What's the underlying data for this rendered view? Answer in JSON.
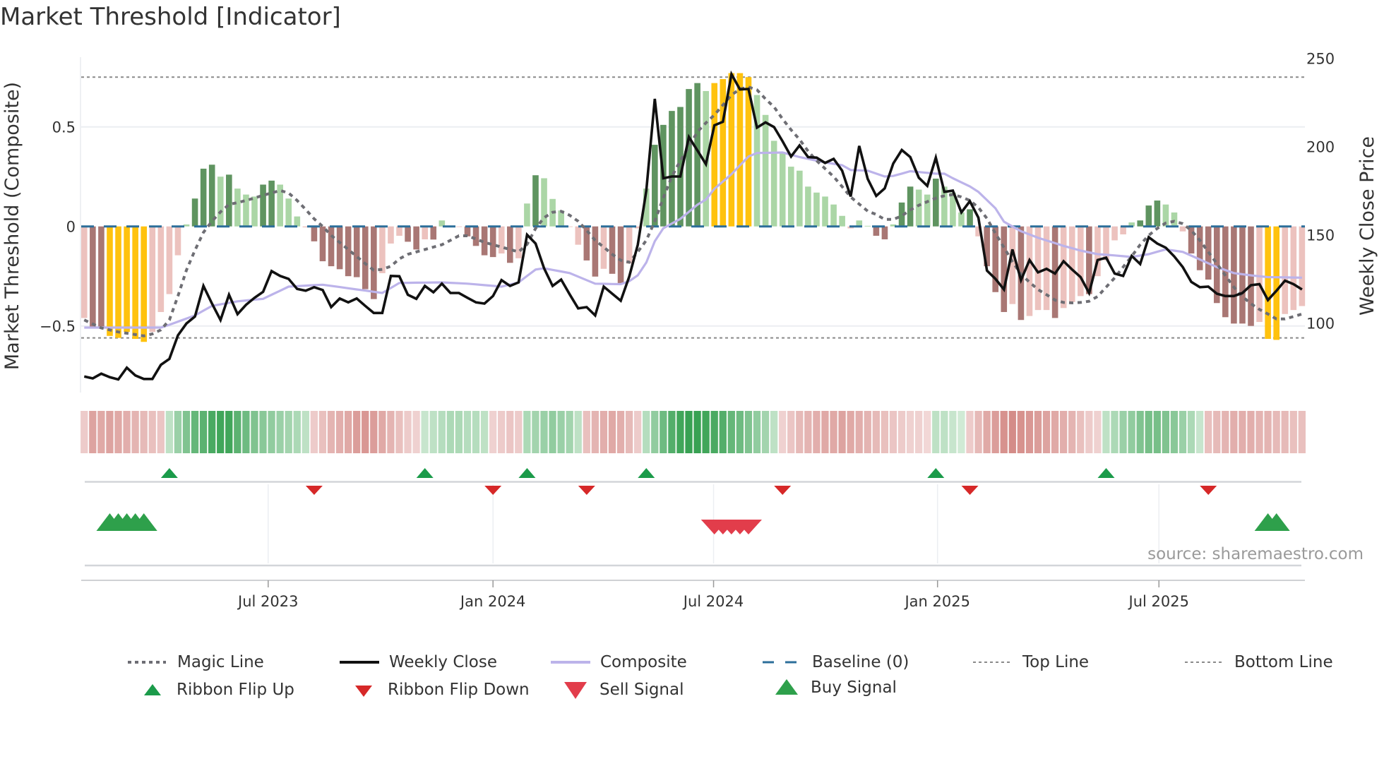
{
  "title": "Market Threshold [Indicator]",
  "source": "source: sharemaestro.com",
  "colors": {
    "bar_dark_red": "#a97774",
    "bar_light_red": "#ecc2be",
    "bar_dark_green": "#5f9460",
    "bar_light_green": "#abd6a6",
    "bar_yellow": "#ffc20e",
    "close": "#111111",
    "composite": "#bcb3ea",
    "magic": "#6e6e74",
    "baseline": "#2c6e9a",
    "threshold": "#8a8a8a",
    "flip_up": "#1b9b4a",
    "flip_down": "#d62828",
    "sell": "#e23d4b",
    "buy": "#2ea04b"
  },
  "chart_data": {
    "type": "bar+line",
    "title": "Market Threshold [Indicator]",
    "ylabel_left": "Market Threshold (Composite)",
    "ylabel_right": "Weekly Close Price",
    "ylim_left": [
      -0.85,
      0.85
    ],
    "ylim_right": [
      50,
      265
    ],
    "y_ticks_left": [
      {
        "label": "0.5",
        "value": 0.5
      },
      {
        "label": "0",
        "value": 0
      },
      {
        "label": "−0.5",
        "value": -0.5
      }
    ],
    "y_ticks_right": [
      {
        "label": "250",
        "value": 250
      },
      {
        "label": "200",
        "value": 200
      },
      {
        "label": "150",
        "value": 150
      },
      {
        "label": "100",
        "value": 100
      }
    ],
    "x_ticks": [
      {
        "label": "Jul 2023",
        "week": 22.6
      },
      {
        "label": "Jan 2024",
        "week": 49
      },
      {
        "label": "Jul 2024",
        "week": 74.9
      },
      {
        "label": "Jan 2025",
        "week": 101.2
      },
      {
        "label": "Jul 2025",
        "week": 127.2
      }
    ],
    "top_line": 0.75,
    "bottom_line": -0.56,
    "baseline": 0,
    "composite_bars": [
      -0.46,
      -0.51,
      -0.51,
      -0.55,
      -0.56,
      -0.53,
      -0.565,
      -0.58,
      -0.53,
      -0.43,
      -0.34,
      -0.145,
      0.01,
      0.14,
      0.29,
      0.31,
      0.25,
      0.26,
      0.19,
      0.16,
      0.15,
      0.21,
      0.23,
      0.21,
      0.14,
      0.05,
      -0.005,
      -0.075,
      -0.175,
      -0.2,
      -0.215,
      -0.25,
      -0.255,
      -0.315,
      -0.365,
      -0.235,
      -0.086,
      -0.047,
      -0.077,
      -0.116,
      -0.065,
      -0.066,
      0.03,
      0.003,
      -0.003,
      -0.05,
      -0.098,
      -0.145,
      -0.154,
      -0.136,
      -0.183,
      -0.16,
      0.115,
      0.257,
      0.242,
      0.138,
      0.08,
      -0.003,
      -0.092,
      -0.171,
      -0.252,
      -0.213,
      -0.238,
      -0.287,
      -0.187,
      -0.01,
      0.19,
      0.41,
      0.51,
      0.58,
      0.6,
      0.69,
      0.72,
      0.68,
      0.72,
      0.74,
      0.77,
      0.77,
      0.75,
      0.66,
      0.56,
      0.43,
      0.37,
      0.3,
      0.28,
      0.2,
      0.17,
      0.15,
      0.11,
      0.053,
      -0.01,
      0.03,
      0.003,
      -0.047,
      -0.065,
      0.01,
      0.12,
      0.2,
      0.185,
      0.16,
      0.24,
      0.2,
      0.17,
      0.07,
      0.086,
      -0.05,
      -0.2,
      -0.33,
      -0.43,
      -0.39,
      -0.47,
      -0.45,
      -0.42,
      -0.42,
      -0.46,
      -0.41,
      -0.38,
      -0.35,
      -0.34,
      -0.25,
      -0.17,
      -0.07,
      -0.04,
      0.02,
      0.03,
      0.105,
      0.13,
      0.11,
      0.07,
      -0.025,
      -0.136,
      -0.22,
      -0.267,
      -0.385,
      -0.456,
      -0.488,
      -0.488,
      -0.5,
      -0.48,
      -0.565,
      -0.57,
      -0.44,
      -0.42,
      -0.4
    ],
    "bar_states": "LDDYYYYYLLLLgGGGgGgggGGgggLDDDDDDDDLLLDDLDggLDDDDLDLgGgggLLDDLDDLLgGGGGGGgYYYYYgggggggggggLggDDgGGggGgggGLDDDLDLLLDLLLDLLLLgGGGggLDDDDDDDDLYYLLL",
    "bar_state_legend": {
      "D": "strong negative",
      "L": "weak negative",
      "G": "strong positive",
      "g": "weak positive",
      "Y": "extreme"
    },
    "weekly_close": [
      69.7,
      68.6,
      71.3,
      69.3,
      68,
      74.7,
      70.3,
      68.3,
      68.3,
      76.3,
      79.7,
      93,
      99.7,
      103.7,
      121,
      111,
      101.7,
      116,
      105,
      110.3,
      114.3,
      117.7,
      129.4,
      126.7,
      125,
      119.3,
      118.3,
      120.3,
      118.7,
      109,
      113.9,
      111.7,
      113.9,
      109.7,
      105.7,
      105.7,
      126.7,
      126.5,
      116,
      113.7,
      121,
      117.4,
      122.3,
      117,
      117,
      114.3,
      111.7,
      111,
      115.3,
      124.3,
      121,
      123,
      150,
      145,
      131,
      121,
      124.6,
      116.3,
      108.3,
      109,
      104.3,
      120.6,
      116.6,
      112.6,
      126.3,
      144.3,
      175,
      227,
      182,
      183,
      183,
      205.4,
      197.8,
      190,
      212,
      214,
      241,
      232.3,
      232.6,
      210.7,
      213.7,
      211,
      203,
      194.3,
      200.6,
      194,
      193.7,
      190.7,
      193,
      186.3,
      171.7,
      200.3,
      181.7,
      172,
      176.3,
      190.3,
      198,
      194,
      182.3,
      177.7,
      193.7,
      174.3,
      175,
      162.7,
      169,
      159.7,
      129.7,
      125,
      119,
      141.7,
      124.3,
      135.7,
      128.7,
      130.7,
      128,
      135,
      130.3,
      126,
      117,
      135.7,
      137,
      128,
      126.7,
      138,
      133.4,
      148.6,
      145,
      142.7,
      137.7,
      131.7,
      123.3,
      120.3,
      120.6,
      116.6,
      115.3,
      115.3,
      117,
      121.4,
      122,
      113,
      118.3,
      124,
      122,
      119
    ],
    "composite_line_knots": [
      [
        1,
        97.4
      ],
      [
        10,
        97.4
      ],
      [
        11,
        99
      ],
      [
        14,
        104.3
      ],
      [
        16,
        109.7
      ],
      [
        19,
        112.3
      ],
      [
        22,
        113.7
      ],
      [
        25,
        120.6
      ],
      [
        29,
        121.7
      ],
      [
        36,
        117
      ],
      [
        38,
        122.7
      ],
      [
        43,
        123
      ],
      [
        46,
        122.3
      ],
      [
        50,
        120.6
      ],
      [
        52,
        123
      ],
      [
        54,
        130.3
      ],
      [
        55,
        131
      ],
      [
        58,
        128.3
      ],
      [
        61,
        122.3
      ],
      [
        64,
        122
      ],
      [
        65,
        123.7
      ],
      [
        66,
        127
      ],
      [
        67,
        134.3
      ],
      [
        68,
        146.3
      ],
      [
        69,
        153.7
      ],
      [
        71,
        159
      ],
      [
        73,
        167
      ],
      [
        74,
        170
      ],
      [
        75,
        176
      ],
      [
        77,
        184.3
      ],
      [
        79,
        194.3
      ],
      [
        80,
        196.3
      ],
      [
        83,
        196.6
      ],
      [
        85,
        194
      ],
      [
        88,
        191
      ],
      [
        90,
        189.4
      ],
      [
        91,
        186.7
      ],
      [
        93,
        186.3
      ],
      [
        95,
        183
      ],
      [
        96,
        183.3
      ],
      [
        98,
        186
      ],
      [
        101,
        184.6
      ],
      [
        102,
        184.6
      ],
      [
        103,
        182
      ],
      [
        105,
        177.4
      ],
      [
        106,
        174.3
      ],
      [
        108,
        165
      ],
      [
        109,
        157.4
      ],
      [
        111,
        152
      ],
      [
        113,
        148.3
      ],
      [
        116,
        143.7
      ],
      [
        118,
        141
      ],
      [
        120,
        139
      ],
      [
        122,
        138.3
      ],
      [
        124,
        137.4
      ],
      [
        126,
        139
      ],
      [
        128,
        141.7
      ],
      [
        130,
        140.3
      ],
      [
        132,
        136
      ],
      [
        134,
        131.7
      ],
      [
        136,
        128.3
      ],
      [
        138,
        127
      ],
      [
        140,
        126
      ],
      [
        144,
        125.7
      ]
    ],
    "magic_line_knots": [
      [
        1,
        -0.47
      ],
      [
        3,
        -0.51
      ],
      [
        5,
        -0.53
      ],
      [
        8,
        -0.55
      ],
      [
        9,
        -0.54
      ],
      [
        10,
        -0.52
      ],
      [
        11,
        -0.47
      ],
      [
        12,
        -0.35
      ],
      [
        13,
        -0.22
      ],
      [
        14,
        -0.12
      ],
      [
        15,
        -0.03
      ],
      [
        16,
        0.026
      ],
      [
        17,
        0.073
      ],
      [
        18,
        0.11
      ],
      [
        20,
        0.13
      ],
      [
        22,
        0.156
      ],
      [
        24,
        0.18
      ],
      [
        25,
        0.168
      ],
      [
        26,
        0.13
      ],
      [
        27,
        0.085
      ],
      [
        28,
        0.038
      ],
      [
        29,
        0
      ],
      [
        30,
        -0.045
      ],
      [
        32,
        -0.116
      ],
      [
        34,
        -0.187
      ],
      [
        35,
        -0.22
      ],
      [
        36,
        -0.216
      ],
      [
        37,
        -0.2
      ],
      [
        38,
        -0.163
      ],
      [
        39,
        -0.14
      ],
      [
        41,
        -0.116
      ],
      [
        43,
        -0.092
      ],
      [
        44,
        -0.07
      ],
      [
        45,
        -0.047
      ],
      [
        46,
        -0.047
      ],
      [
        47,
        -0.063
      ],
      [
        48,
        -0.08
      ],
      [
        50,
        -0.104
      ],
      [
        52,
        -0.128
      ],
      [
        53,
        -0.09
      ],
      [
        54,
        -0.01
      ],
      [
        55,
        0.044
      ],
      [
        56,
        0.071
      ],
      [
        57,
        0.076
      ],
      [
        58,
        0.056
      ],
      [
        59,
        0.026
      ],
      [
        60,
        -0.02
      ],
      [
        61,
        -0.07
      ],
      [
        62,
        -0.104
      ],
      [
        63,
        -0.14
      ],
      [
        64,
        -0.17
      ],
      [
        65,
        -0.18
      ],
      [
        66,
        -0.128
      ],
      [
        67,
        -0.07
      ],
      [
        68,
        0.026
      ],
      [
        69,
        0.144
      ],
      [
        70,
        0.25
      ],
      [
        71,
        0.33
      ],
      [
        72,
        0.4
      ],
      [
        73,
        0.475
      ],
      [
        74,
        0.52
      ],
      [
        75,
        0.56
      ],
      [
        76,
        0.61
      ],
      [
        77,
        0.66
      ],
      [
        78,
        0.69
      ],
      [
        79,
        0.7
      ],
      [
        80,
        0.686
      ],
      [
        81,
        0.64
      ],
      [
        82,
        0.6
      ],
      [
        83,
        0.54
      ],
      [
        84,
        0.485
      ],
      [
        85,
        0.437
      ],
      [
        86,
        0.378
      ],
      [
        87,
        0.33
      ],
      [
        88,
        0.29
      ],
      [
        89,
        0.25
      ],
      [
        90,
        0.2
      ],
      [
        91,
        0.148
      ],
      [
        92,
        0.112
      ],
      [
        93,
        0.077
      ],
      [
        94,
        0.06
      ],
      [
        95,
        0.035
      ],
      [
        96,
        0.035
      ],
      [
        97,
        0.053
      ],
      [
        98,
        0.083
      ],
      [
        99,
        0.106
      ],
      [
        100,
        0.124
      ],
      [
        101,
        0.142
      ],
      [
        102,
        0.154
      ],
      [
        103,
        0.16
      ],
      [
        104,
        0.148
      ],
      [
        105,
        0.13
      ],
      [
        106,
        0.095
      ],
      [
        107,
        0.04
      ],
      [
        108,
        -0.035
      ],
      [
        109,
        -0.106
      ],
      [
        110,
        -0.177
      ],
      [
        111,
        -0.24
      ],
      [
        112,
        -0.28
      ],
      [
        113,
        -0.317
      ],
      [
        114,
        -0.343
      ],
      [
        115,
        -0.37
      ],
      [
        116,
        -0.382
      ],
      [
        117,
        -0.384
      ],
      [
        118,
        -0.382
      ],
      [
        119,
        -0.376
      ],
      [
        120,
        -0.352
      ],
      [
        121,
        -0.305
      ],
      [
        122,
        -0.258
      ],
      [
        123,
        -0.204
      ],
      [
        124,
        -0.15
      ],
      [
        125,
        -0.092
      ],
      [
        126,
        -0.045
      ],
      [
        127,
        -0.01
      ],
      [
        128,
        0.017
      ],
      [
        129,
        0.026
      ],
      [
        130,
        0.014
      ],
      [
        131,
        -0.02
      ],
      [
        132,
        -0.07
      ],
      [
        133,
        -0.128
      ],
      [
        134,
        -0.187
      ],
      [
        135,
        -0.246
      ],
      [
        136,
        -0.305
      ],
      [
        137,
        -0.352
      ],
      [
        138,
        -0.388
      ],
      [
        139,
        -0.417
      ],
      [
        140,
        -0.44
      ],
      [
        141,
        -0.465
      ],
      [
        142,
        -0.465
      ],
      [
        143,
        -0.453
      ],
      [
        144,
        -0.44
      ]
    ],
    "ribbon_strength": [
      -0.2,
      -0.55,
      -0.5,
      -0.55,
      -0.5,
      -0.45,
      -0.4,
      -0.35,
      -0.3,
      -0.25,
      0.2,
      0.4,
      0.55,
      0.7,
      0.75,
      0.85,
      0.9,
      0.9,
      0.75,
      0.65,
      0.55,
      0.5,
      0.45,
      0.4,
      0.35,
      0.3,
      0.2,
      -0.2,
      -0.3,
      -0.4,
      -0.45,
      -0.5,
      -0.6,
      -0.65,
      -0.6,
      -0.5,
      -0.4,
      -0.3,
      -0.2,
      -0.15,
      0.15,
      0.2,
      0.25,
      0.3,
      0.3,
      0.25,
      0.25,
      0.2,
      -0.15,
      -0.2,
      -0.25,
      -0.2,
      0.3,
      0.35,
      0.4,
      0.45,
      0.4,
      0.35,
      0.2,
      -0.3,
      -0.4,
      -0.45,
      -0.5,
      -0.45,
      -0.35,
      -0.2,
      0.25,
      0.45,
      0.65,
      0.8,
      0.9,
      0.95,
      0.95,
      0.9,
      0.85,
      0.8,
      0.7,
      0.65,
      0.55,
      0.45,
      0.35,
      0.2,
      -0.15,
      -0.25,
      -0.35,
      -0.4,
      -0.45,
      -0.5,
      -0.5,
      -0.55,
      -0.5,
      -0.45,
      -0.4,
      -0.35,
      -0.3,
      -0.25,
      -0.2,
      -0.15,
      -0.15,
      -0.1,
      0.2,
      0.2,
      0.15,
      0.1,
      -0.2,
      -0.35,
      -0.5,
      -0.6,
      -0.7,
      -0.75,
      -0.7,
      -0.65,
      -0.6,
      -0.55,
      -0.5,
      -0.45,
      -0.4,
      -0.3,
      -0.2,
      -0.15,
      0.2,
      0.3,
      0.4,
      0.45,
      0.55,
      0.6,
      0.6,
      0.55,
      0.5,
      0.4,
      0.3,
      0.15,
      -0.3,
      -0.35,
      -0.4,
      -0.45,
      -0.45,
      -0.45,
      -0.4,
      -0.4,
      -0.35,
      -0.35,
      -0.3,
      -0.3
    ],
    "ribbon_flip_up_weeks": [
      11,
      41,
      53,
      67,
      101,
      121
    ],
    "ribbon_flip_down_weeks": [
      28,
      49,
      60,
      83,
      105,
      133
    ],
    "buy_signal_weeks": [
      4,
      5,
      6,
      7,
      8,
      140,
      141
    ],
    "sell_signal_weeks": [
      75,
      76,
      77,
      78,
      79
    ],
    "legend_placement": "bottom"
  },
  "legend": {
    "magic_line": "Magic Line",
    "weekly_close": "Weekly Close",
    "composite": "Composite",
    "baseline": "Baseline (0)",
    "top_line": "Top Line",
    "bottom_line": "Bottom Line",
    "ribbon_flip_up": "Ribbon Flip Up",
    "ribbon_flip_down": "Ribbon Flip Down",
    "sell_signal": "Sell Signal",
    "buy_signal": "Buy Signal"
  }
}
